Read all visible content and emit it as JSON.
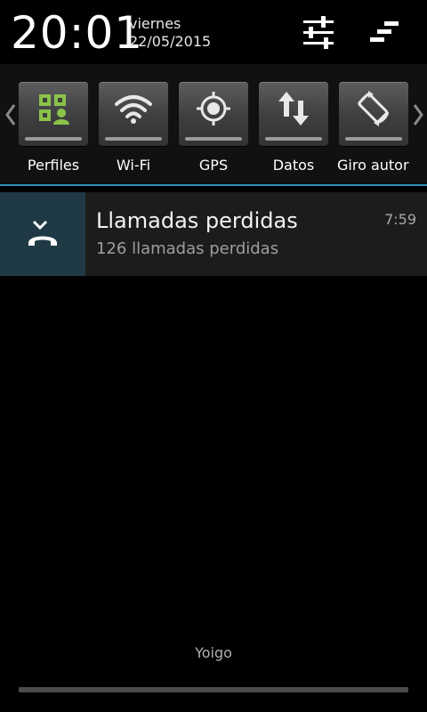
{
  "header": {
    "time": "20:01",
    "day": "viernes",
    "date": "22/05/2015",
    "settings_icon": "sliders-icon",
    "clear_icon": "clear-all-icon"
  },
  "quick_settings": {
    "tiles": [
      {
        "label": "Perfiles",
        "icon": "profiles-icon",
        "color": "#8bc34a"
      },
      {
        "label": "Wi-Fi",
        "icon": "wifi-icon"
      },
      {
        "label": "GPS",
        "icon": "gps-icon"
      },
      {
        "label": "Datos",
        "icon": "data-transfer-icon"
      },
      {
        "label": "Giro autor",
        "icon": "auto-rotate-icon"
      }
    ]
  },
  "notification": {
    "icon": "missed-call-icon",
    "title": "Llamadas perdidas",
    "subtitle": "126 llamadas perdidas",
    "time": "7:59"
  },
  "carrier": "Yoigo",
  "colors": {
    "accent": "#2f8fb5",
    "notif_icon_bg": "#1f3a45",
    "profiles_green": "#8bc34a"
  }
}
